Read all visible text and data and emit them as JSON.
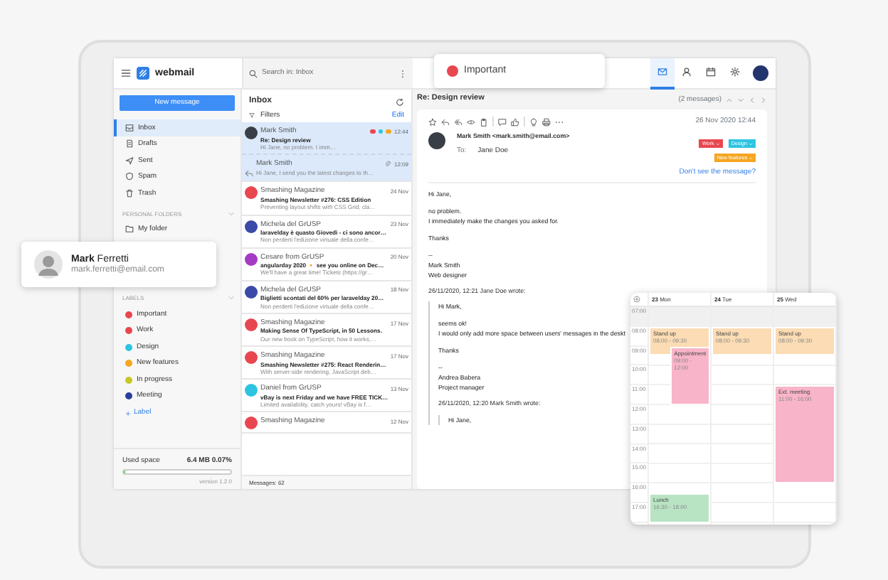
{
  "app": {
    "logo": "webmail",
    "search_placeholder": "Search in: Inbox"
  },
  "apps": [
    {
      "selected": true
    },
    {
      "selected": false
    },
    {
      "selected": false
    },
    {
      "selected": false
    }
  ],
  "sidebar": {
    "new_message": "New message",
    "folders": [
      {
        "label": "Inbox",
        "selected": true
      },
      {
        "label": "Drafts",
        "selected": false
      },
      {
        "label": "Sent",
        "selected": false
      },
      {
        "label": "Spam",
        "selected": false
      },
      {
        "label": "Trash",
        "selected": false
      }
    ],
    "personal_heading": "PERSONAL FOLDERS",
    "personal_folders": [
      {
        "label": "My folder"
      }
    ],
    "labels_heading": "LABELS",
    "labels": [
      {
        "label": "Important",
        "color": "#e8474f"
      },
      {
        "label": "Work",
        "color": "#e8474f"
      },
      {
        "label": "Design",
        "color": "#2ec4e0"
      },
      {
        "label": "New features",
        "color": "#f5a623"
      },
      {
        "label": "In progress",
        "color": "#c5c825"
      },
      {
        "label": "Meeting",
        "color": "#2c3e9c"
      }
    ],
    "add_label": "Label",
    "used_space_label": "Used space",
    "used_space": "6.4 MB  0.07%",
    "level": 0.01,
    "version": "version 1.2.0"
  },
  "inbox": {
    "title": "Inbox",
    "filters": "Filters",
    "edit": "Edit",
    "footer": "Messages: 62",
    "messages": [
      {
        "kind": "message",
        "sender": "Mark Smith",
        "subject": "Re: Design review",
        "preview": "Hi Jane, no problem. I imm…",
        "date": "12:44",
        "selected": true,
        "color": "#3a3f47",
        "tags": [
          {
            "color": "#e8474f"
          },
          {
            "color": "#2ec4e0"
          },
          {
            "color": "#f5a623"
          }
        ]
      },
      {
        "kind": "reply",
        "sender": "Mark Smith",
        "preview": "Hi Jane, I send you the latest changes to th…",
        "date": "12:09",
        "selected": true
      },
      {
        "kind": "message",
        "sender": "Smashing Magazine",
        "subject": "Smashing Newsletter #276: CSS Edition",
        "preview": "Preventing layout shifts with CSS Grid, cla…",
        "date": "24 Nov",
        "selected": false,
        "color": "#e8474f"
      },
      {
        "kind": "message",
        "sender": "Michela del GrUSP",
        "subject": "laravelday è quasto Giovedì - ci sono ancor…",
        "preview": "Non perderti l'edizione virtuale della confe…",
        "date": "23 Nov",
        "selected": false,
        "color": "#3b4aa8"
      },
      {
        "kind": "message",
        "sender": "Cesare from GrUSP",
        "subject": "angularday 2020 🔸 see you online on Dec…",
        "preview": "We'll have a great time! Tickets (https://gr…",
        "date": "20 Nov",
        "selected": false,
        "color": "#a33cc2"
      },
      {
        "kind": "message",
        "sender": "Michela del GrUSP",
        "subject": "Biglietti scontati del 60% per laravelday 20…",
        "preview": "Non perderti l'edizione virtuale della confe…",
        "date": "18 Nov",
        "selected": false,
        "color": "#3b4aa8"
      },
      {
        "kind": "message",
        "sender": "Smashing Magazine",
        "subject": "Making Sense Of TypeScript, in 50 Lessons.",
        "preview": "Our new book on TypeScript, how it works,…",
        "date": "17 Nov",
        "selected": false,
        "color": "#e8474f"
      },
      {
        "kind": "message",
        "sender": "Smashing Magazine",
        "subject": "Smashing Newsletter #275: React Renderin…",
        "preview": "With server-side rendering, JavaScript deb…",
        "date": "17 Nov",
        "selected": false,
        "color": "#e8474f"
      },
      {
        "kind": "message",
        "sender": "Daniel from GrUSP",
        "subject": "vBay is next Friday and we have FREE TICK…",
        "preview": "Limited availability, catch yours! vBay is f…",
        "date": "13 Nov",
        "selected": false,
        "color": "#2ec4e0"
      },
      {
        "kind": "message",
        "sender": "Smashing Magazine",
        "date": "12 Nov",
        "selected": false,
        "color": "#e8474f"
      }
    ]
  },
  "reading": {
    "title": "Re: Design review",
    "count": "(2 messages)",
    "date": "26 Nov 2020 12:44",
    "from": "Mark Smith <mark.smith@email.com>",
    "to_label": "To:",
    "to": "Jane Doe",
    "tags": [
      {
        "label": "Work",
        "color": "#e8474f"
      },
      {
        "label": "Design",
        "color": "#2ec4e0"
      },
      {
        "label": "New features",
        "color": "#f5a623"
      }
    ],
    "notice": "Don't see the message?",
    "body": {
      "paragraphs": [
        [
          "Hi Jane,"
        ],
        [
          "no problem.",
          "I immediately make the changes you asked for."
        ],
        [
          "Thanks"
        ],
        [
          "--",
          "Mark Smith",
          "Web designer"
        ]
      ],
      "quote": {
        "header": "26/11/2020, 12:21 Jane Doe wrote:",
        "paragraphs": [
          [
            "Hi Mark,"
          ],
          [
            "seems ok!",
            "I would only add more space between users' messages in the deskt"
          ],
          [
            "Thanks"
          ],
          [
            "--",
            "Andrea Babera",
            "Project manager"
          ]
        ],
        "quote": {
          "header": "26/11/2020, 12:20 Mark Smith  wrote:",
          "paragraphs": [
            [
              "Hi Jane,"
            ]
          ]
        }
      }
    }
  },
  "label_popup": {
    "label": "Important",
    "color": "#e8474f"
  },
  "contact_popup": {
    "name": "**Mark** Ferretti",
    "email": "mark.ferretti@email.com"
  },
  "calendar": {
    "hours": [
      {
        "label": "07:00",
        "shaded": true
      },
      {
        "label": "08:00",
        "shaded": false
      },
      {
        "label": "09:00",
        "shaded": false
      },
      {
        "label": "10:00",
        "shaded": false
      },
      {
        "label": "11:00",
        "shaded": false
      },
      {
        "label": "12:00",
        "shaded": false
      },
      {
        "label": "13:00",
        "shaded": false
      },
      {
        "label": "14:00",
        "shaded": false
      },
      {
        "label": "15:00",
        "shaded": false
      },
      {
        "label": "16:00",
        "shaded": false
      },
      {
        "label": "17:00",
        "shaded": false
      }
    ],
    "days": [
      {
        "label": "**23** Mon",
        "events": [
          {
            "title": "Stand up",
            "time": "08:00 - 09:30",
            "color": "#fbdcb4"
          },
          {
            "title": "Appointment",
            "time": "09:00 - 12:00",
            "color": "#f8b4c8"
          },
          {
            "title": "Lunch",
            "time": "16:30 - 18:00",
            "color": "#b9e4c4"
          }
        ]
      },
      {
        "label": "**24** Tue",
        "events": [
          {
            "title": "Stand up",
            "time": "08:00 - 09:30",
            "color": "#fbdcb4"
          }
        ]
      },
      {
        "label": "**25** Wed",
        "events": [
          {
            "title": "Stand up",
            "time": "08:00 - 09:30",
            "color": "#fbdcb4"
          },
          {
            "title": "Ext. meeting",
            "time": "11:00 - 16:00",
            "color": "#f8b4c8"
          }
        ]
      }
    ]
  }
}
